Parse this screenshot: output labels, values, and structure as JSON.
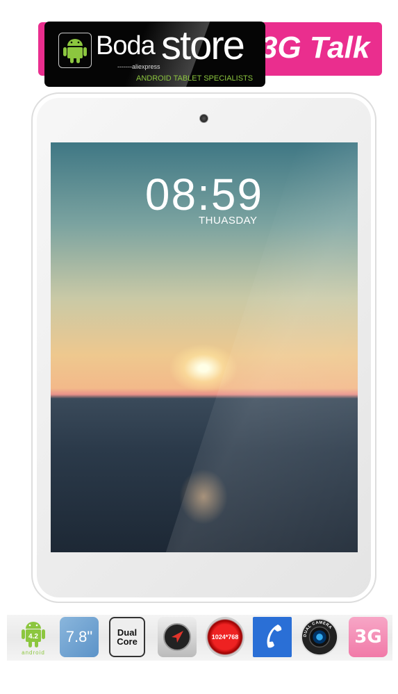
{
  "header": {
    "brand_part1": "Boda",
    "brand_part2": "store",
    "sub": "-------aliexpress",
    "tagline": "ANDROID TABLET SPECIALISTS",
    "product": "3G Talk",
    "accent": "#ea2e8e",
    "tagline_color": "#8cc63f"
  },
  "lockscreen": {
    "time": "08:59",
    "day": "THUASDAY"
  },
  "features": [
    {
      "icon": "android-icon",
      "label": "4.2",
      "sub": "android"
    },
    {
      "icon": "screen-size-icon",
      "label": "7.8\""
    },
    {
      "icon": "cpu-icon",
      "label": "Dual Core"
    },
    {
      "icon": "gps-icon"
    },
    {
      "icon": "resolution-icon",
      "label": "1024*768"
    },
    {
      "icon": "phone-icon"
    },
    {
      "icon": "dual-camera-icon",
      "label": "DUAL CAMERA"
    },
    {
      "icon": "3g-icon",
      "label": "3G"
    }
  ]
}
